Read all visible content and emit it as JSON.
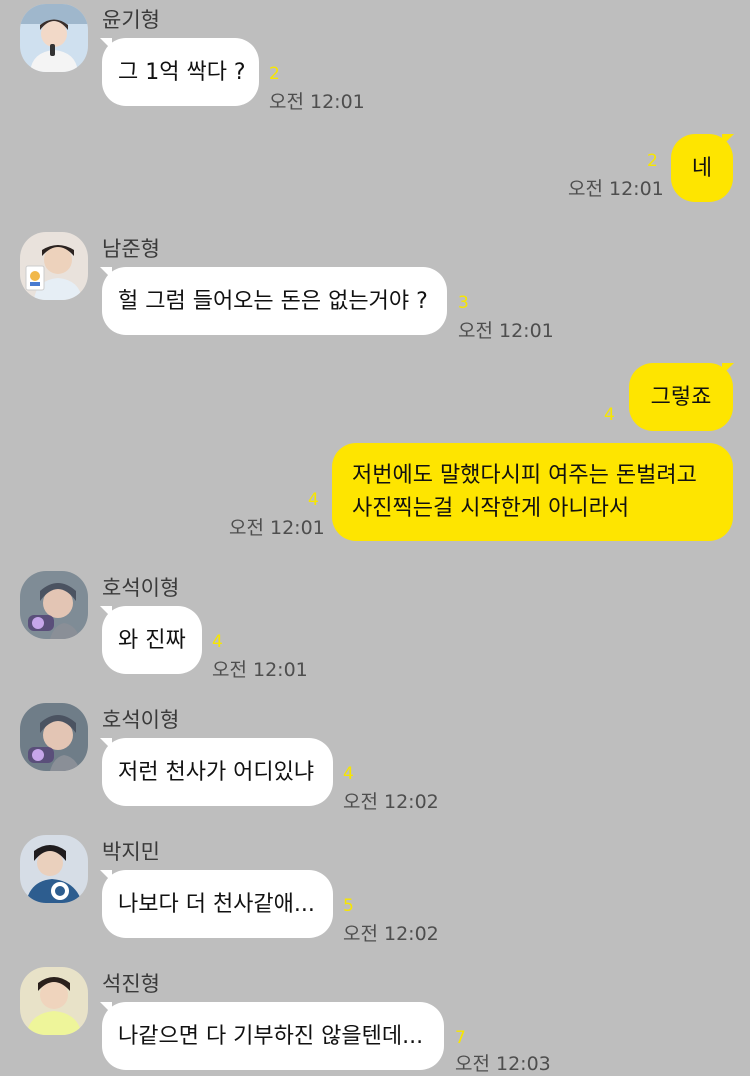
{
  "messages": [
    {
      "sender": "윤기형",
      "text": "그 1억 싹다 ?",
      "unread": "2",
      "time": "오전 12:01"
    },
    {
      "text": "네",
      "unread": "2",
      "time": "오전 12:01"
    },
    {
      "sender": "남준형",
      "text": "헐 그럼 들어오는 돈은 없는거야 ?",
      "unread": "3",
      "time": "오전 12:01"
    },
    {
      "text": "그렇죠",
      "unread": "4"
    },
    {
      "lines": [
        "저번에도 말했다시피 여주는 돈벌려고",
        "사진찍는걸 시작한게 아니라서"
      ],
      "unread": "4",
      "time": "오전 12:01"
    },
    {
      "sender": "호석이형",
      "text": "와 진짜",
      "unread": "4",
      "time": "오전 12:01"
    },
    {
      "sender": "호석이형",
      "text": "저런 천사가 어디있냐",
      "unread": "4",
      "time": "오전 12:02"
    },
    {
      "sender": "박지민",
      "text": "나보다 더 천사같애...",
      "unread": "5",
      "time": "오전 12:02"
    },
    {
      "sender": "석진형",
      "text": "나같으면 다 기부하진 않을텐데...",
      "unread": "7",
      "time": "오전 12:03"
    }
  ],
  "avatars": [
    {
      "bg": "#cfe0ef",
      "skin": "#f2d9c8",
      "hair": "#3a2e2a",
      "shirt": "#f4f4f4"
    },
    {
      "bg": "#e9e2dc",
      "skin": "#edd2bc",
      "hair": "#2b2320",
      "shirt": "#e6eef5"
    },
    {
      "bg": "#7f8c96",
      "skin": "#e3c5b4",
      "hair": "#4b5361",
      "shirt": "#5a4f7a"
    },
    {
      "bg": "#6f7d88",
      "skin": "#e3c5b4",
      "hair": "#4b5361",
      "shirt": "#5a4f7a"
    },
    {
      "bg": "#d6dde6",
      "skin": "#ead0bd",
      "hair": "#1f1c1e",
      "shirt": "#2d5d8f"
    },
    {
      "bg": "#e8e2c8",
      "skin": "#efd4bd",
      "hair": "#2a201c",
      "shirt": "#eef59a"
    }
  ],
  "colors": {
    "background": "#bebebe",
    "incoming_bubble": "#ffffff",
    "outgoing_bubble": "#fee500",
    "unread_count": "#f7e600"
  }
}
